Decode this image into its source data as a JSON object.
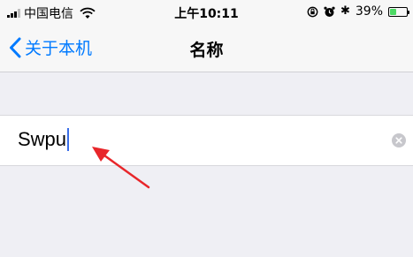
{
  "status_bar": {
    "carrier": "中国电信",
    "time": "上午10:11",
    "battery_percent_label": "39%",
    "battery_level": 0.39,
    "icons": [
      "signal-icon",
      "wifi-icon",
      "rotation-lock-icon",
      "alarm-icon",
      "bluetooth-icon",
      "battery-icon"
    ]
  },
  "nav": {
    "back_label": "关于本机",
    "title": "名称"
  },
  "name_field": {
    "value": "Swpu"
  },
  "colors": {
    "accent": "#007aff",
    "background": "#efeff4",
    "annotation_arrow": "#e8262a",
    "battery_fill": "#4cd964",
    "caret": "#3a6ee8"
  }
}
